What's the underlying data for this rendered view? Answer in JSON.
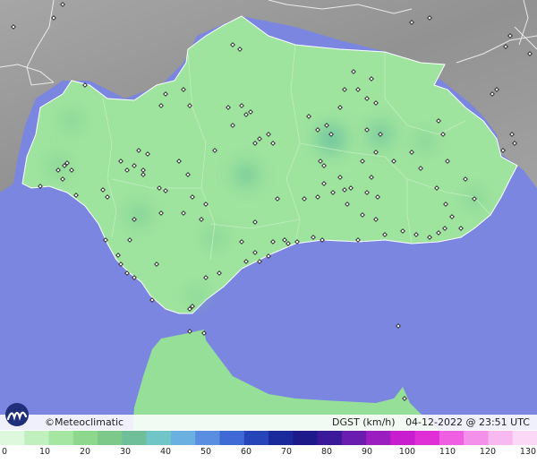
{
  "brand": {
    "copyright_symbol": "©",
    "name": "Meteoclimatic"
  },
  "info": {
    "variable": "DGST (km/h)",
    "datetime": "04-12-2022 @ 23:51 UTC"
  },
  "scale": {
    "ticks": [
      "0",
      "10",
      "20",
      "30",
      "40",
      "50",
      "60",
      "70",
      "80",
      "90",
      "100",
      "110",
      "120",
      "130"
    ],
    "min": 0,
    "max": 130,
    "colors": [
      "#ddf8dc",
      "#bff0bd",
      "#a4e6a2",
      "#8ed88d",
      "#7cc98a",
      "#6fbf9a",
      "#70c6c6",
      "#6ab0e0",
      "#5a8ee0",
      "#3f6ad6",
      "#2545b8",
      "#1a2a9a",
      "#1e1a8a",
      "#3b1a9a",
      "#6a1cb0",
      "#9a1ec0",
      "#c81ed0",
      "#e12fd8",
      "#ee5fe2",
      "#f490ea",
      "#f8b8f0",
      "#fbd8f6"
    ]
  },
  "colors": {
    "sea": "#7b86e0",
    "land": "#9ee39e",
    "land_dark": "#7fcf8a",
    "outside": "#9c9c9c",
    "border": "#ffffff"
  }
}
